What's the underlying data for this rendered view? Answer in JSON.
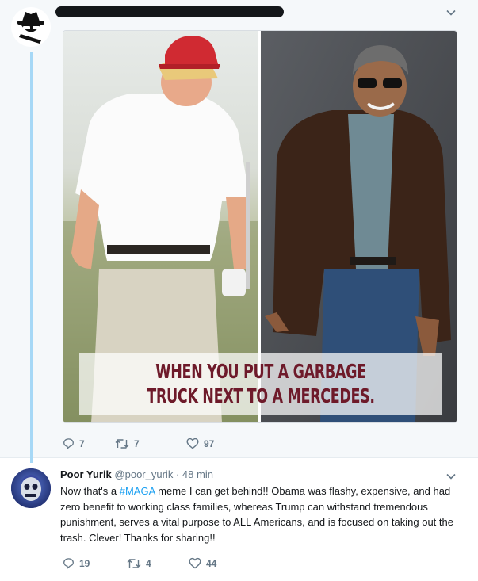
{
  "tweet1": {
    "meme_caption": "WHEN YOU PUT A GARBAGE TRUCK NEXT TO A MERCEDES.",
    "actions": {
      "replies": "7",
      "retweets": "7",
      "likes": "97"
    }
  },
  "tweet2": {
    "display_name": "Poor Yurik",
    "handle": "@poor_yurik",
    "separator": "·",
    "time": "48 min",
    "text_before": "Now that's a ",
    "hashtag": "#MAGA",
    "text_after": " meme I can get behind!! Obama was flashy, expensive, and had zero benefit to working class families, whereas Trump can withstand tremendous punishment, serves a vital purpose to ALL Americans, and is focused on taking out the trash. Clever! Thanks for sharing!!",
    "actions": {
      "replies": "19",
      "retweets": "4",
      "likes": "44"
    }
  },
  "icons": {
    "reply": "reply-icon",
    "retweet": "retweet-icon",
    "like": "heart-icon",
    "menu": "chevron-down-icon"
  },
  "colors": {
    "accent": "#1da1f2",
    "thread_line": "#a6d8f6",
    "muted": "#657786",
    "caption": "#6e1a2a"
  }
}
